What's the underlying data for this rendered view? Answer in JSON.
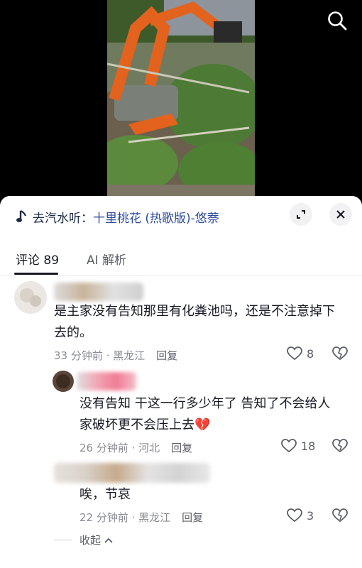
{
  "video": {
    "description_icon": "search-icon"
  },
  "music": {
    "prefix": "去汽水听：",
    "song": "十里桃花 (热歌版)-悠萘"
  },
  "tabs": [
    {
      "label": "评论 89",
      "active": true
    },
    {
      "label": "AI 解析",
      "active": false
    }
  ],
  "comments": [
    {
      "text_line1": "是主家没有告知那里有化粪池吗，还是不注意掉下",
      "text_line2": "去的。",
      "time_location": "33 分钟前 · 黑龙江",
      "reply_label": "回复",
      "likes": "8"
    },
    {
      "text_line1": "没有告知  干这一行多少年了  告知了不会给人",
      "text_line2": "家破坏更不会压上去",
      "emoji": "💔",
      "time_location": "26 分钟前 · 河北",
      "reply_label": "回复",
      "likes": "18"
    },
    {
      "text_line1": "唉，节哀",
      "time_location": "22 分钟前 · 黑龙江",
      "reply_label": "回复",
      "likes": "3"
    }
  ],
  "collapse_label": "收起",
  "colors": {
    "link": "#2d4a9a",
    "muted": "#8a8c93",
    "text": "#161823"
  }
}
